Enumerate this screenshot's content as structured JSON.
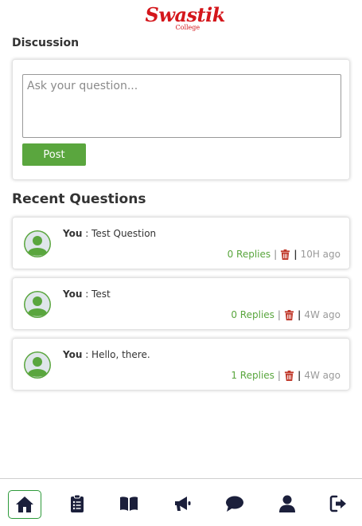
{
  "brand": {
    "logo_text": "Swastik",
    "logo_sub": "College",
    "color": "#d4161b"
  },
  "discussion": {
    "heading": "Discussion",
    "placeholder": "Ask your question...",
    "post_label": "Post"
  },
  "recent": {
    "heading": "Recent Questions",
    "questions": [
      {
        "author": "You",
        "separator": " : ",
        "text": "Test Question",
        "replies": "0 Replies",
        "age": "10H ago"
      },
      {
        "author": "You",
        "separator": " : ",
        "text": "Test",
        "replies": "0 Replies",
        "age": "4W ago"
      },
      {
        "author": "You",
        "separator": " : ",
        "text": "Hello, there.",
        "replies": "1 Replies",
        "age": "4W ago"
      }
    ]
  },
  "separators": {
    "light": "|",
    "dark": "|"
  },
  "nav": {
    "items": [
      {
        "icon": "home-icon",
        "active": true
      },
      {
        "icon": "clipboard-icon",
        "active": false
      },
      {
        "icon": "book-icon",
        "active": false
      },
      {
        "icon": "megaphone-icon",
        "active": false
      },
      {
        "icon": "chat-icon",
        "active": false
      },
      {
        "icon": "user-icon",
        "active": false
      },
      {
        "icon": "logout-icon",
        "active": false
      }
    ]
  },
  "colors": {
    "accent": "#5aa63e",
    "delete": "#c0392b",
    "nav_icon": "#1b1f3b",
    "avatar_green": "#5aa63e"
  }
}
